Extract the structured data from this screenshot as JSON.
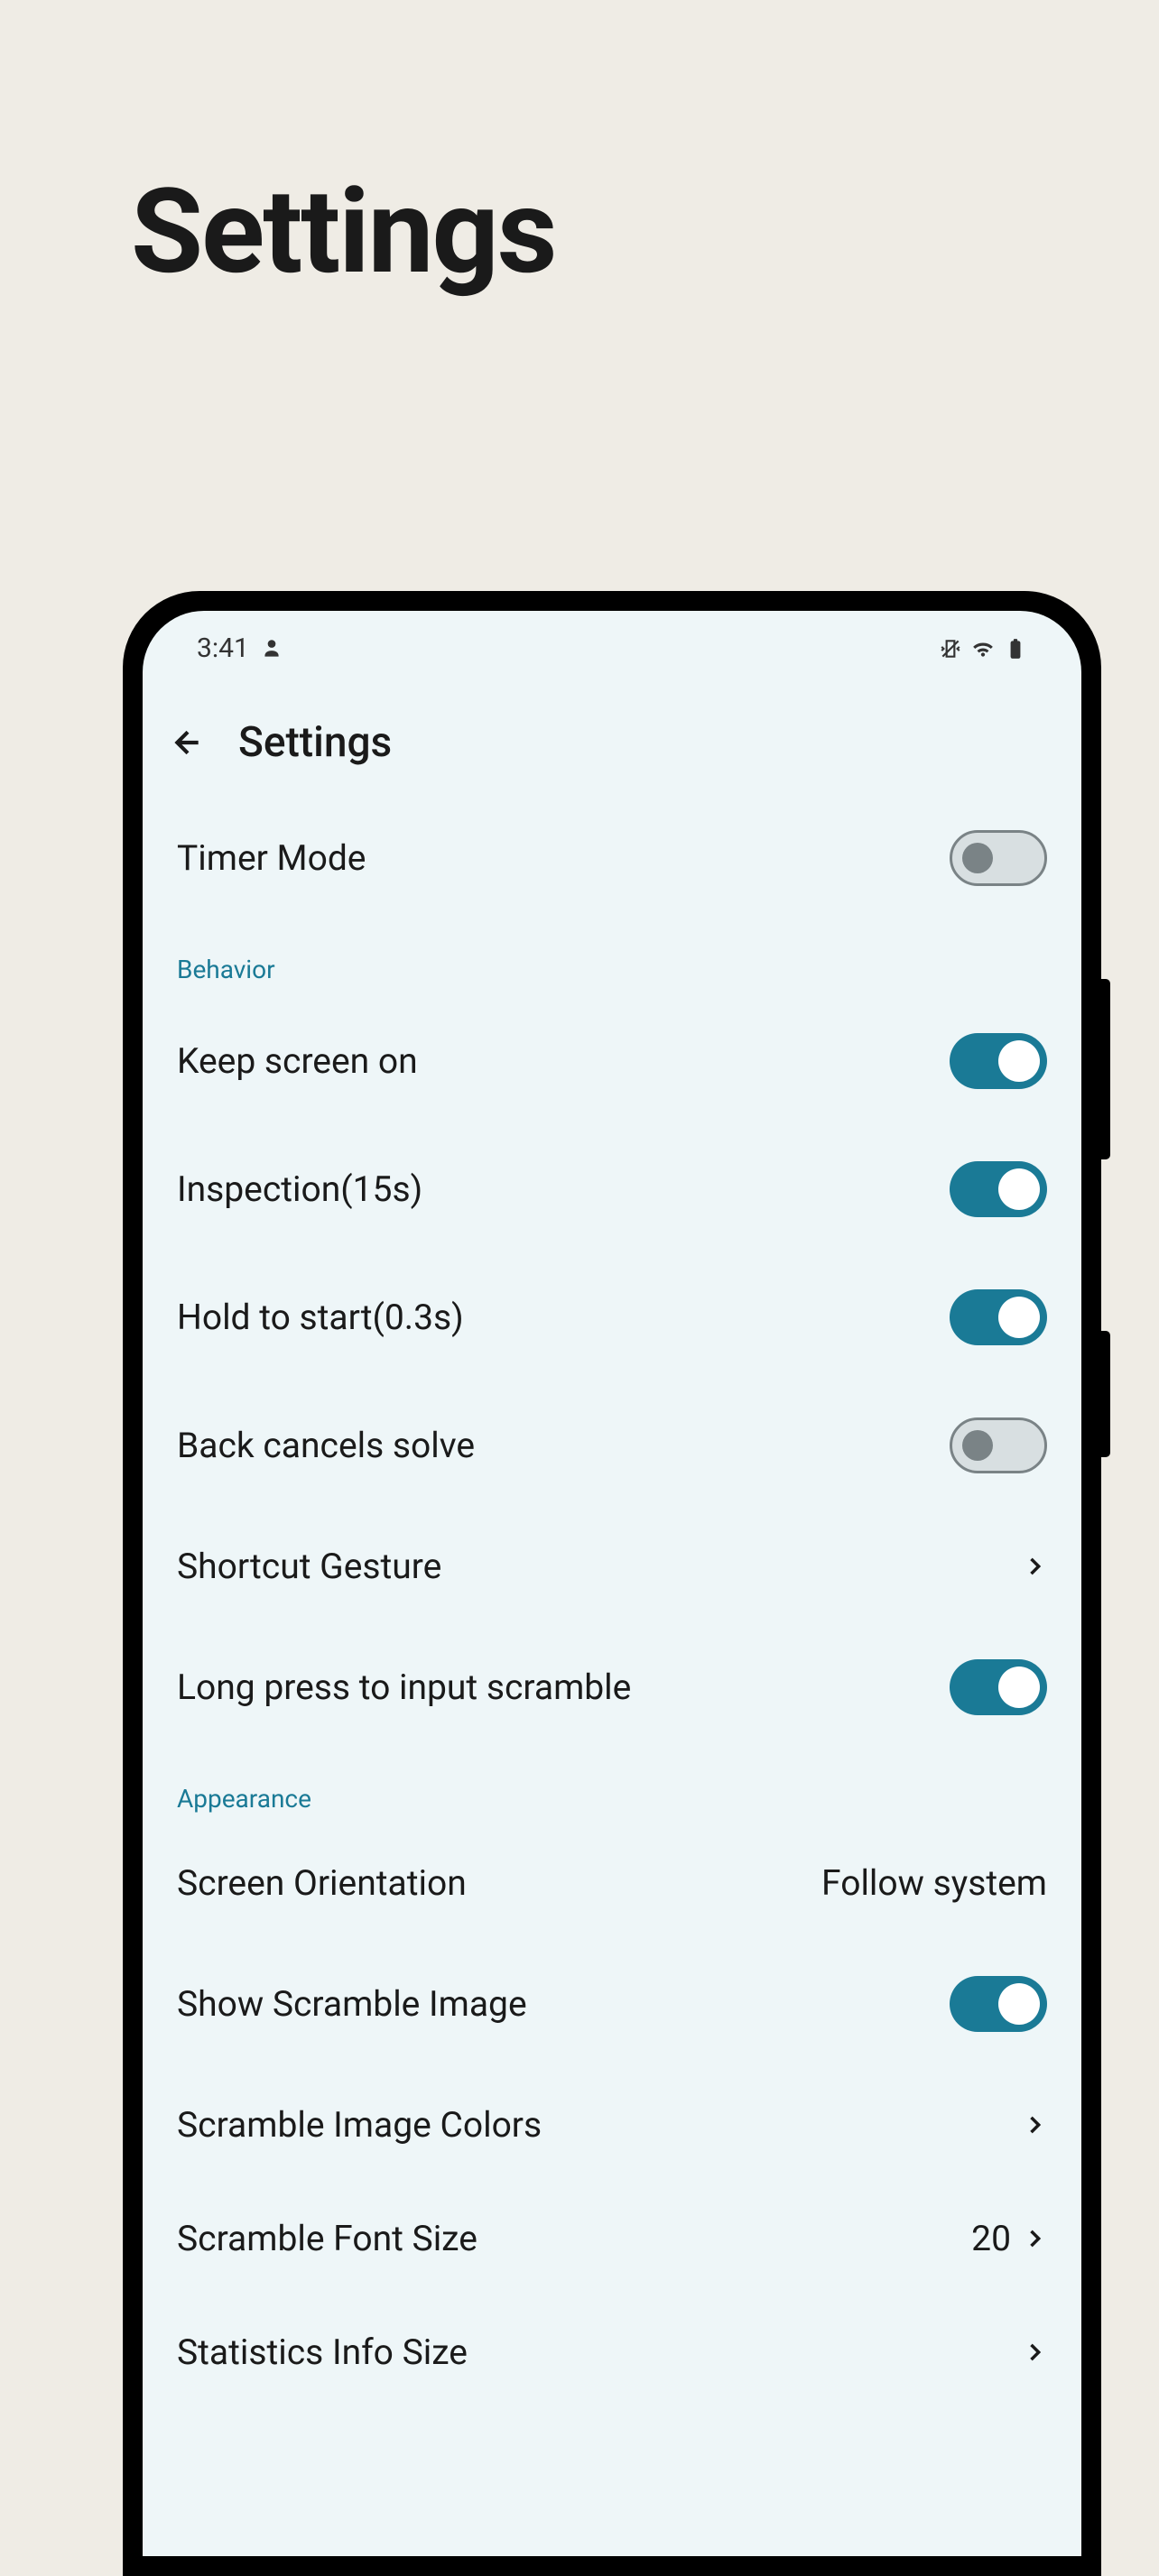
{
  "page_title": "Settings",
  "status_bar": {
    "time": "3:41"
  },
  "header": {
    "title": "Settings"
  },
  "settings": {
    "timer_mode": {
      "label": "Timer Mode",
      "enabled": false
    },
    "section_behavior": "Behavior",
    "keep_screen_on": {
      "label": "Keep screen on",
      "enabled": true
    },
    "inspection": {
      "label": "Inspection(15s)",
      "enabled": true
    },
    "hold_to_start": {
      "label": "Hold to start(0.3s)",
      "enabled": true
    },
    "back_cancels_solve": {
      "label": "Back cancels solve",
      "enabled": false
    },
    "shortcut_gesture": {
      "label": "Shortcut Gesture"
    },
    "long_press_scramble": {
      "label": "Long press to input scramble",
      "enabled": true
    },
    "section_appearance": "Appearance",
    "screen_orientation": {
      "label": "Screen Orientation",
      "value": "Follow system"
    },
    "show_scramble_image": {
      "label": "Show Scramble Image",
      "enabled": true
    },
    "scramble_image_colors": {
      "label": "Scramble Image Colors"
    },
    "scramble_font_size": {
      "label": "Scramble Font Size",
      "value": "20"
    },
    "statistics_info_size": {
      "label": "Statistics Info Size"
    }
  }
}
